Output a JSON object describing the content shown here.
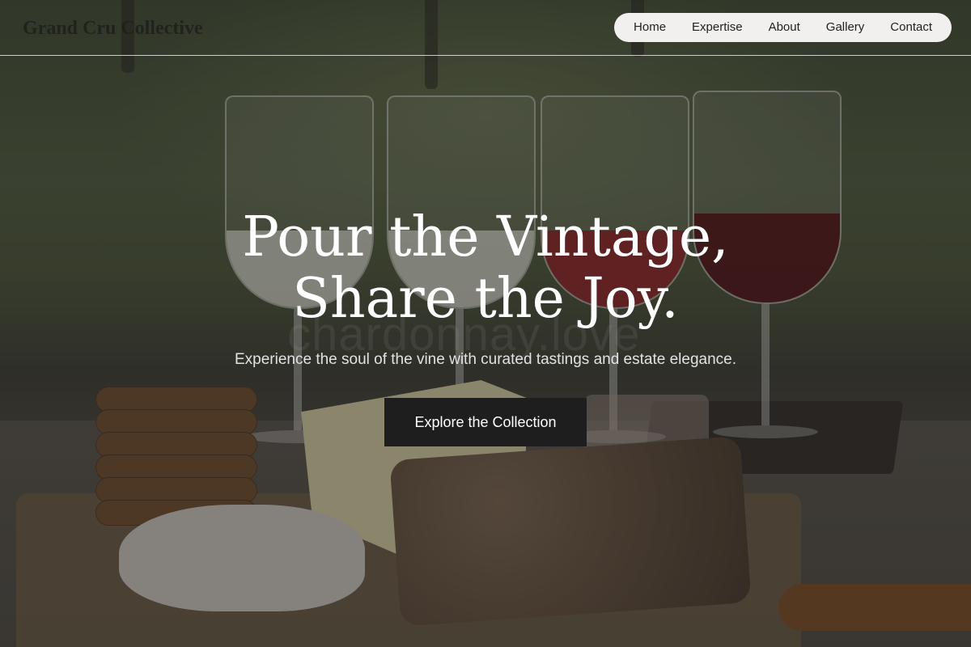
{
  "header": {
    "logo": "Grand Cru Collective",
    "nav": [
      "Home",
      "Expertise",
      "About",
      "Gallery",
      "Contact"
    ]
  },
  "hero": {
    "title": "Pour the Vintage, Share the Joy.",
    "subtitle": "Experience the soul of the vine with curated tastings and estate elegance.",
    "cta_label": "Explore the Collection",
    "image_watermark": "chardonnay.love"
  },
  "colors": {
    "cta_background": "#1f1e1f",
    "nav_pill": "#f1f0ee",
    "text_light": "#ffffff"
  }
}
